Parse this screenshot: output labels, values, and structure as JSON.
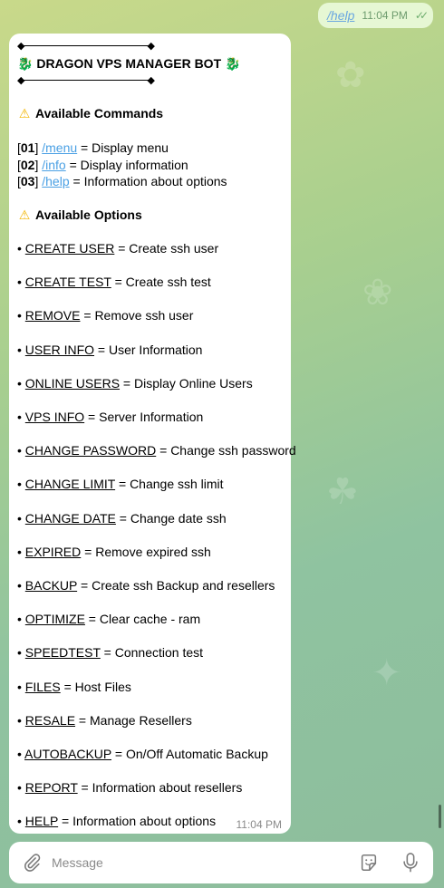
{
  "outgoing": {
    "command": "/help",
    "time": "11:04 PM",
    "status_icon": "double-check-icon"
  },
  "bot_message": {
    "title": "DRAGON VPS MANAGER BOT",
    "title_icon": "🐉",
    "commands_heading": "Available Commands",
    "commands": [
      {
        "num": "01",
        "cmd": "/menu",
        "desc": " = Display menu"
      },
      {
        "num": "02",
        "cmd": "/info",
        "desc": " = Display information"
      },
      {
        "num": "03",
        "cmd": "/help",
        "desc": " = Information about options"
      }
    ],
    "options_heading": "Available Options",
    "options": [
      {
        "name": "CREATE USER",
        "desc": " = Create ssh user"
      },
      {
        "name": "CREATE TEST",
        "desc": " = Create ssh test"
      },
      {
        "name": "REMOVE",
        "desc": " = Remove ssh user"
      },
      {
        "name": "USER INFO",
        "desc": " = User Information"
      },
      {
        "name": "ONLINE USERS",
        "desc": " = Display Online Users"
      },
      {
        "name": "VPS INFO",
        "desc": " = Server Information"
      },
      {
        "name": "CHANGE PASSWORD",
        "desc": " = Change ssh password"
      },
      {
        "name": "CHANGE LIMIT",
        "desc": " = Change ssh limit"
      },
      {
        "name": "CHANGE DATE",
        "desc": " = Change date ssh"
      },
      {
        "name": "EXPIRED",
        "desc": " = Remove expired ssh"
      },
      {
        "name": "BACKUP",
        "desc": " = Create ssh Backup and resellers"
      },
      {
        "name": "OPTIMIZE",
        "desc": " = Clear cache - ram"
      },
      {
        "name": "SPEEDTEST",
        "desc": " = Connection test"
      },
      {
        "name": "FILES",
        "desc": " = Host Files"
      },
      {
        "name": "RESALE",
        "desc": " = Manage Resellers"
      },
      {
        "name": "AUTOBACKUP",
        "desc": " = On/Off Automatic Backup"
      },
      {
        "name": "REPORT",
        "desc": " = Information about resellers"
      },
      {
        "name": "HELP",
        "desc": " = Information about options"
      }
    ],
    "time": "11:04 PM"
  },
  "input": {
    "placeholder": "Message"
  }
}
